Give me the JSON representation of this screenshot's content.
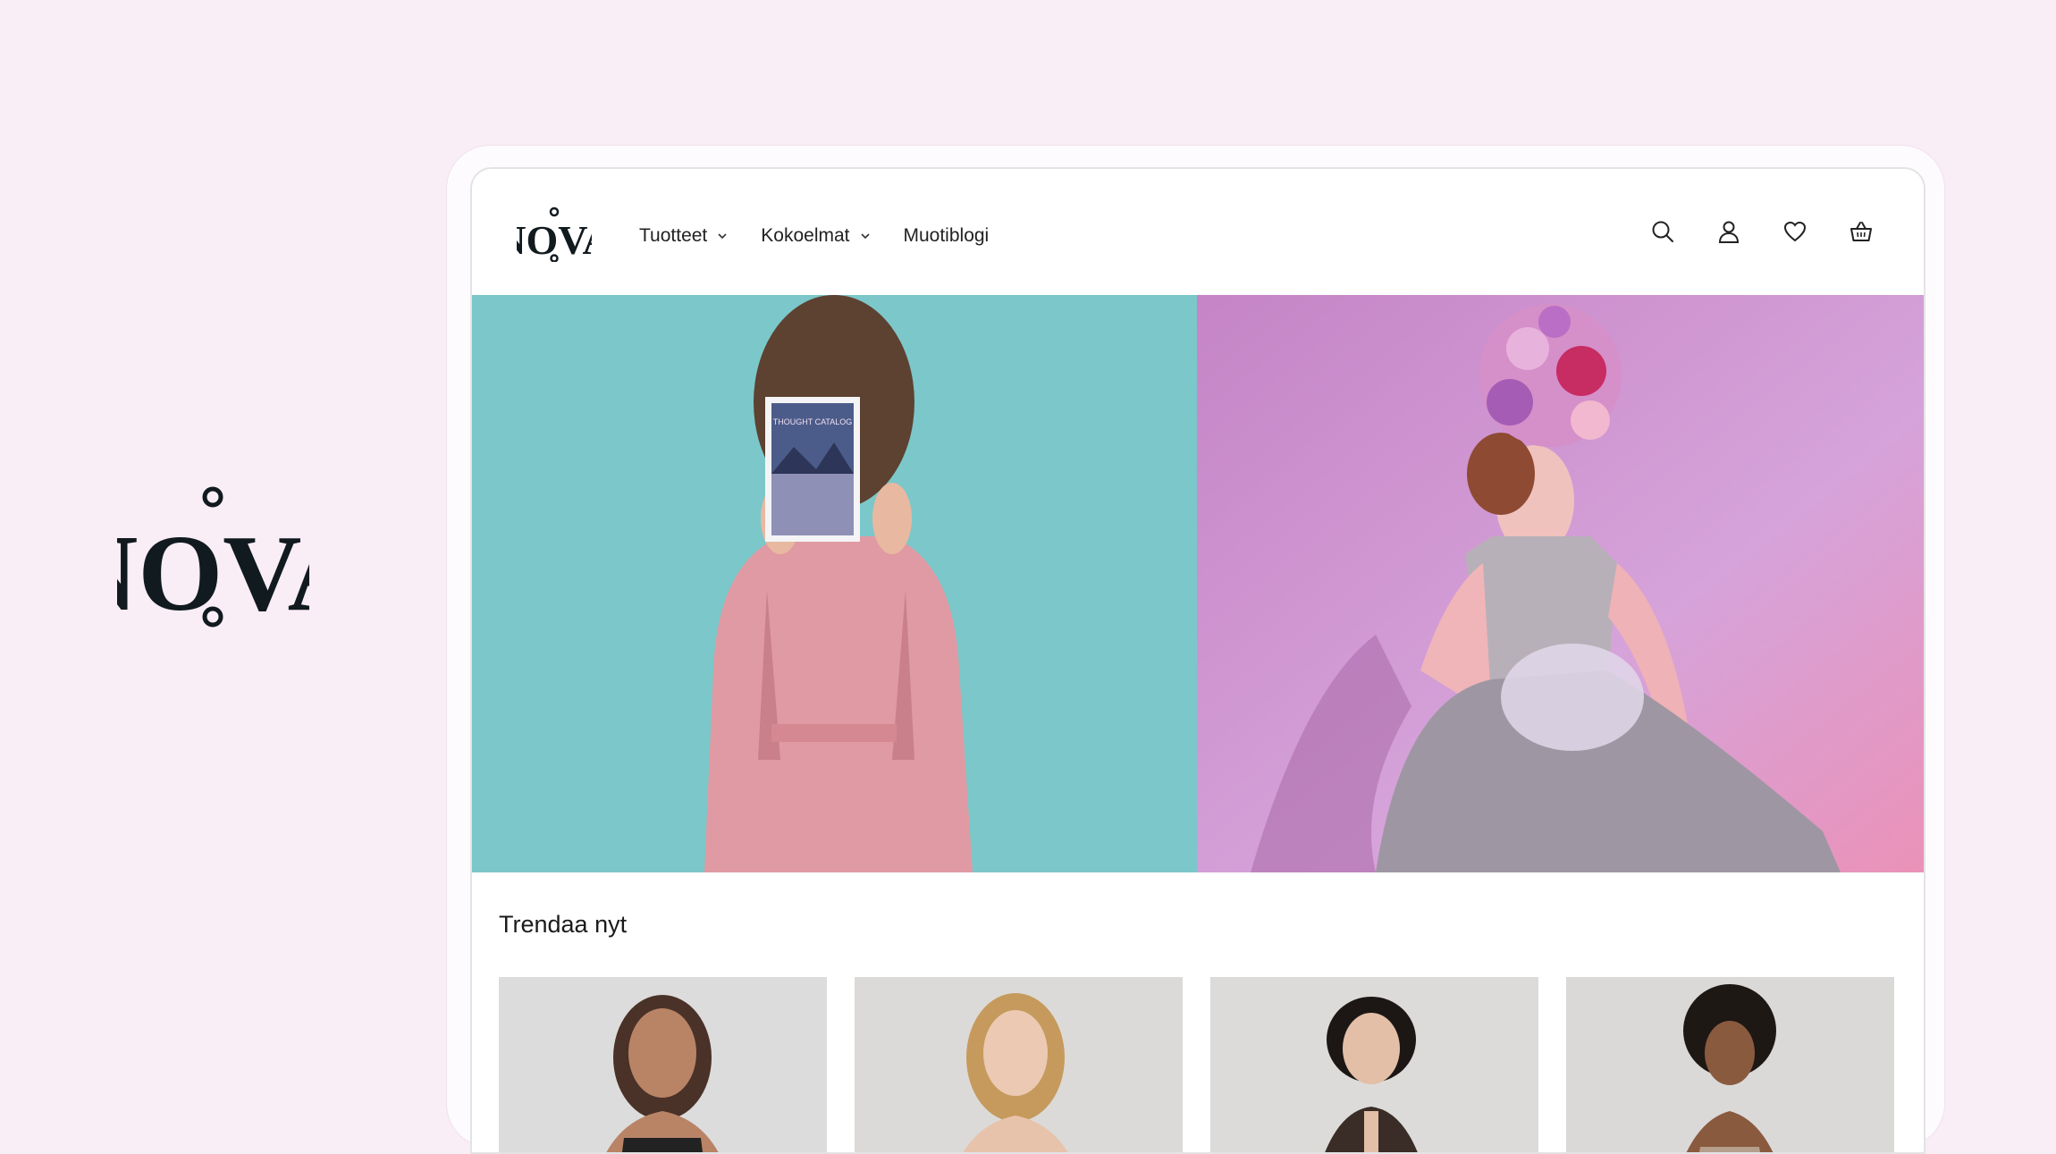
{
  "brand": {
    "logo_text": "NOVA"
  },
  "nav": {
    "items": [
      {
        "label": "Tuotteet",
        "has_dropdown": true
      },
      {
        "label": "Kokoelmat",
        "has_dropdown": true
      },
      {
        "label": "Muotiblogi",
        "has_dropdown": false
      }
    ]
  },
  "header_icons": [
    "search-icon",
    "user-icon",
    "heart-icon",
    "basket-icon"
  ],
  "hero": {
    "left_image": "woman in pink dress holding magazine on teal background",
    "right_image": "model with floral headpiece and silver outfit on pink background",
    "magazine_text": "THOUGHT CATALOG"
  },
  "trending": {
    "title": "Trendaa nyt"
  },
  "colors": {
    "background": "#f9edf6",
    "hero_left": "#7ec9cb",
    "hero_right": "#d9a6dc"
  }
}
